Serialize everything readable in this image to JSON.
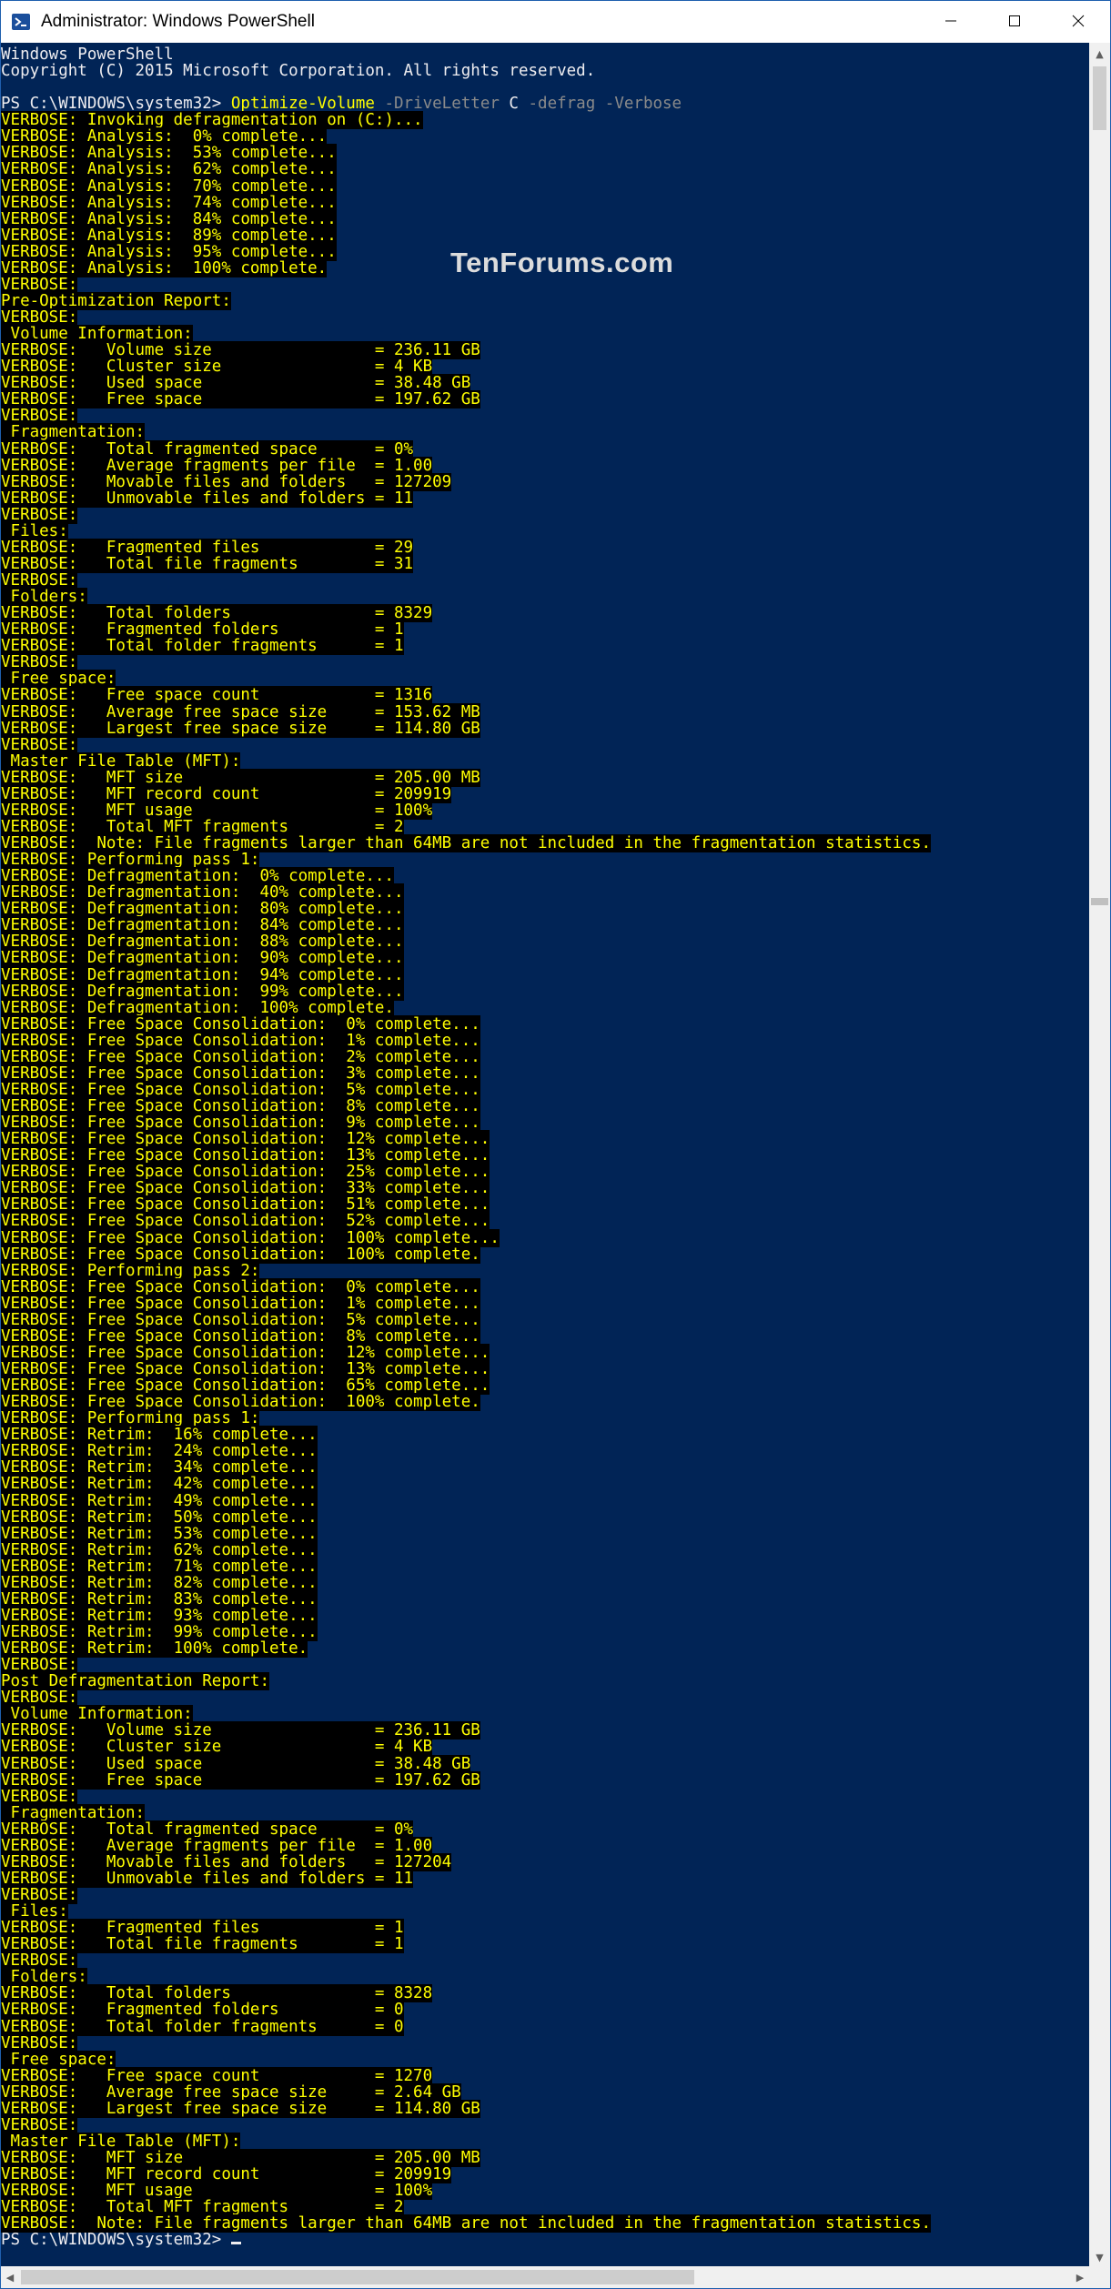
{
  "window": {
    "title": "Administrator: Windows PowerShell",
    "icons": {
      "app": "powershell-icon",
      "minimize": "minimize-icon",
      "maximize": "maximize-icon",
      "close": "close-icon"
    }
  },
  "watermark": "TenForums.com",
  "header": [
    "Windows PowerShell",
    "Copyright (C) 2015 Microsoft Corporation. All rights reserved.",
    ""
  ],
  "command": {
    "prompt": "PS C:\\WINDOWS\\system32> ",
    "cmdlet": "Optimize-Volume",
    "param1": " -DriveLetter",
    "arg1": " C",
    "param2": " -defrag",
    "param3": " -Verbose"
  },
  "verbose_lines": [
    "VERBOSE: Invoking defragmentation on (C:)...",
    "VERBOSE: Analysis:  0% complete...",
    "VERBOSE: Analysis:  53% complete...",
    "VERBOSE: Analysis:  62% complete...",
    "VERBOSE: Analysis:  70% complete...",
    "VERBOSE: Analysis:  74% complete...",
    "VERBOSE: Analysis:  84% complete...",
    "VERBOSE: Analysis:  89% complete...",
    "VERBOSE: Analysis:  95% complete...",
    "VERBOSE: Analysis:  100% complete.",
    "VERBOSE:",
    "Pre-Optimization Report:",
    "VERBOSE:",
    " Volume Information:",
    "VERBOSE:   Volume size                 = 236.11 GB",
    "VERBOSE:   Cluster size                = 4 KB",
    "VERBOSE:   Used space                  = 38.48 GB",
    "VERBOSE:   Free space                  = 197.62 GB",
    "VERBOSE:",
    " Fragmentation:",
    "VERBOSE:   Total fragmented space      = 0%",
    "VERBOSE:   Average fragments per file  = 1.00",
    "VERBOSE:   Movable files and folders   = 127209",
    "VERBOSE:   Unmovable files and folders = 11",
    "VERBOSE:",
    " Files:",
    "VERBOSE:   Fragmented files            = 29",
    "VERBOSE:   Total file fragments        = 31",
    "VERBOSE:",
    " Folders:",
    "VERBOSE:   Total folders               = 8329",
    "VERBOSE:   Fragmented folders          = 1",
    "VERBOSE:   Total folder fragments      = 1",
    "VERBOSE:",
    " Free space:",
    "VERBOSE:   Free space count            = 1316",
    "VERBOSE:   Average free space size     = 153.62 MB",
    "VERBOSE:   Largest free space size     = 114.80 GB",
    "VERBOSE:",
    " Master File Table (MFT):",
    "VERBOSE:   MFT size                    = 205.00 MB",
    "VERBOSE:   MFT record count            = 209919",
    "VERBOSE:   MFT usage                   = 100%",
    "VERBOSE:   Total MFT fragments         = 2",
    "VERBOSE:  Note: File fragments larger than 64MB are not included in the fragmentation statistics.",
    "VERBOSE: Performing pass 1:",
    "VERBOSE: Defragmentation:  0% complete...",
    "VERBOSE: Defragmentation:  40% complete...",
    "VERBOSE: Defragmentation:  80% complete...",
    "VERBOSE: Defragmentation:  84% complete...",
    "VERBOSE: Defragmentation:  88% complete...",
    "VERBOSE: Defragmentation:  90% complete...",
    "VERBOSE: Defragmentation:  94% complete...",
    "VERBOSE: Defragmentation:  99% complete...",
    "VERBOSE: Defragmentation:  100% complete.",
    "VERBOSE: Free Space Consolidation:  0% complete...",
    "VERBOSE: Free Space Consolidation:  1% complete...",
    "VERBOSE: Free Space Consolidation:  2% complete...",
    "VERBOSE: Free Space Consolidation:  3% complete...",
    "VERBOSE: Free Space Consolidation:  5% complete...",
    "VERBOSE: Free Space Consolidation:  8% complete...",
    "VERBOSE: Free Space Consolidation:  9% complete...",
    "VERBOSE: Free Space Consolidation:  12% complete...",
    "VERBOSE: Free Space Consolidation:  13% complete...",
    "VERBOSE: Free Space Consolidation:  25% complete...",
    "VERBOSE: Free Space Consolidation:  33% complete...",
    "VERBOSE: Free Space Consolidation:  51% complete...",
    "VERBOSE: Free Space Consolidation:  52% complete...",
    "VERBOSE: Free Space Consolidation:  100% complete...",
    "VERBOSE: Free Space Consolidation:  100% complete.",
    "VERBOSE: Performing pass 2:",
    "VERBOSE: Free Space Consolidation:  0% complete...",
    "VERBOSE: Free Space Consolidation:  1% complete...",
    "VERBOSE: Free Space Consolidation:  5% complete...",
    "VERBOSE: Free Space Consolidation:  8% complete...",
    "VERBOSE: Free Space Consolidation:  12% complete...",
    "VERBOSE: Free Space Consolidation:  13% complete...",
    "VERBOSE: Free Space Consolidation:  65% complete...",
    "VERBOSE: Free Space Consolidation:  100% complete.",
    "VERBOSE: Performing pass 1:",
    "VERBOSE: Retrim:  16% complete...",
    "VERBOSE: Retrim:  24% complete...",
    "VERBOSE: Retrim:  34% complete...",
    "VERBOSE: Retrim:  42% complete...",
    "VERBOSE: Retrim:  49% complete...",
    "VERBOSE: Retrim:  50% complete...",
    "VERBOSE: Retrim:  53% complete...",
    "VERBOSE: Retrim:  62% complete...",
    "VERBOSE: Retrim:  71% complete...",
    "VERBOSE: Retrim:  82% complete...",
    "VERBOSE: Retrim:  83% complete...",
    "VERBOSE: Retrim:  93% complete...",
    "VERBOSE: Retrim:  99% complete...",
    "VERBOSE: Retrim:  100% complete.",
    "VERBOSE:",
    "Post Defragmentation Report:",
    "VERBOSE:",
    " Volume Information:",
    "VERBOSE:   Volume size                 = 236.11 GB",
    "VERBOSE:   Cluster size                = 4 KB",
    "VERBOSE:   Used space                  = 38.48 GB",
    "VERBOSE:   Free space                  = 197.62 GB",
    "VERBOSE:",
    " Fragmentation:",
    "VERBOSE:   Total fragmented space      = 0%",
    "VERBOSE:   Average fragments per file  = 1.00",
    "VERBOSE:   Movable files and folders   = 127204",
    "VERBOSE:   Unmovable files and folders = 11",
    "VERBOSE:",
    " Files:",
    "VERBOSE:   Fragmented files            = 1",
    "VERBOSE:   Total file fragments        = 1",
    "VERBOSE:",
    " Folders:",
    "VERBOSE:   Total folders               = 8328",
    "VERBOSE:   Fragmented folders          = 0",
    "VERBOSE:   Total folder fragments      = 0",
    "VERBOSE:",
    " Free space:",
    "VERBOSE:   Free space count            = 1270",
    "VERBOSE:   Average free space size     = 2.64 GB",
    "VERBOSE:   Largest free space size     = 114.80 GB",
    "VERBOSE:",
    " Master File Table (MFT):",
    "VERBOSE:   MFT size                    = 205.00 MB",
    "VERBOSE:   MFT record count            = 209919",
    "VERBOSE:   MFT usage                   = 100%",
    "VERBOSE:   Total MFT fragments         = 2",
    "VERBOSE:  Note: File fragments larger than 64MB are not included in the fragmentation statistics."
  ],
  "final_prompt": "PS C:\\WINDOWS\\system32> ",
  "colors": {
    "console_bg": "#012456",
    "verbose_fg": "#ffff00",
    "verbose_bg": "#000000",
    "default_fg": "#eeedf0",
    "parameter_fg": "#8a8a8a"
  },
  "scrollbar_icons": {
    "up": "scroll-up-arrow-icon",
    "down": "scroll-down-arrow-icon",
    "left": "scroll-left-arrow-icon",
    "right": "scroll-right-arrow-icon"
  }
}
